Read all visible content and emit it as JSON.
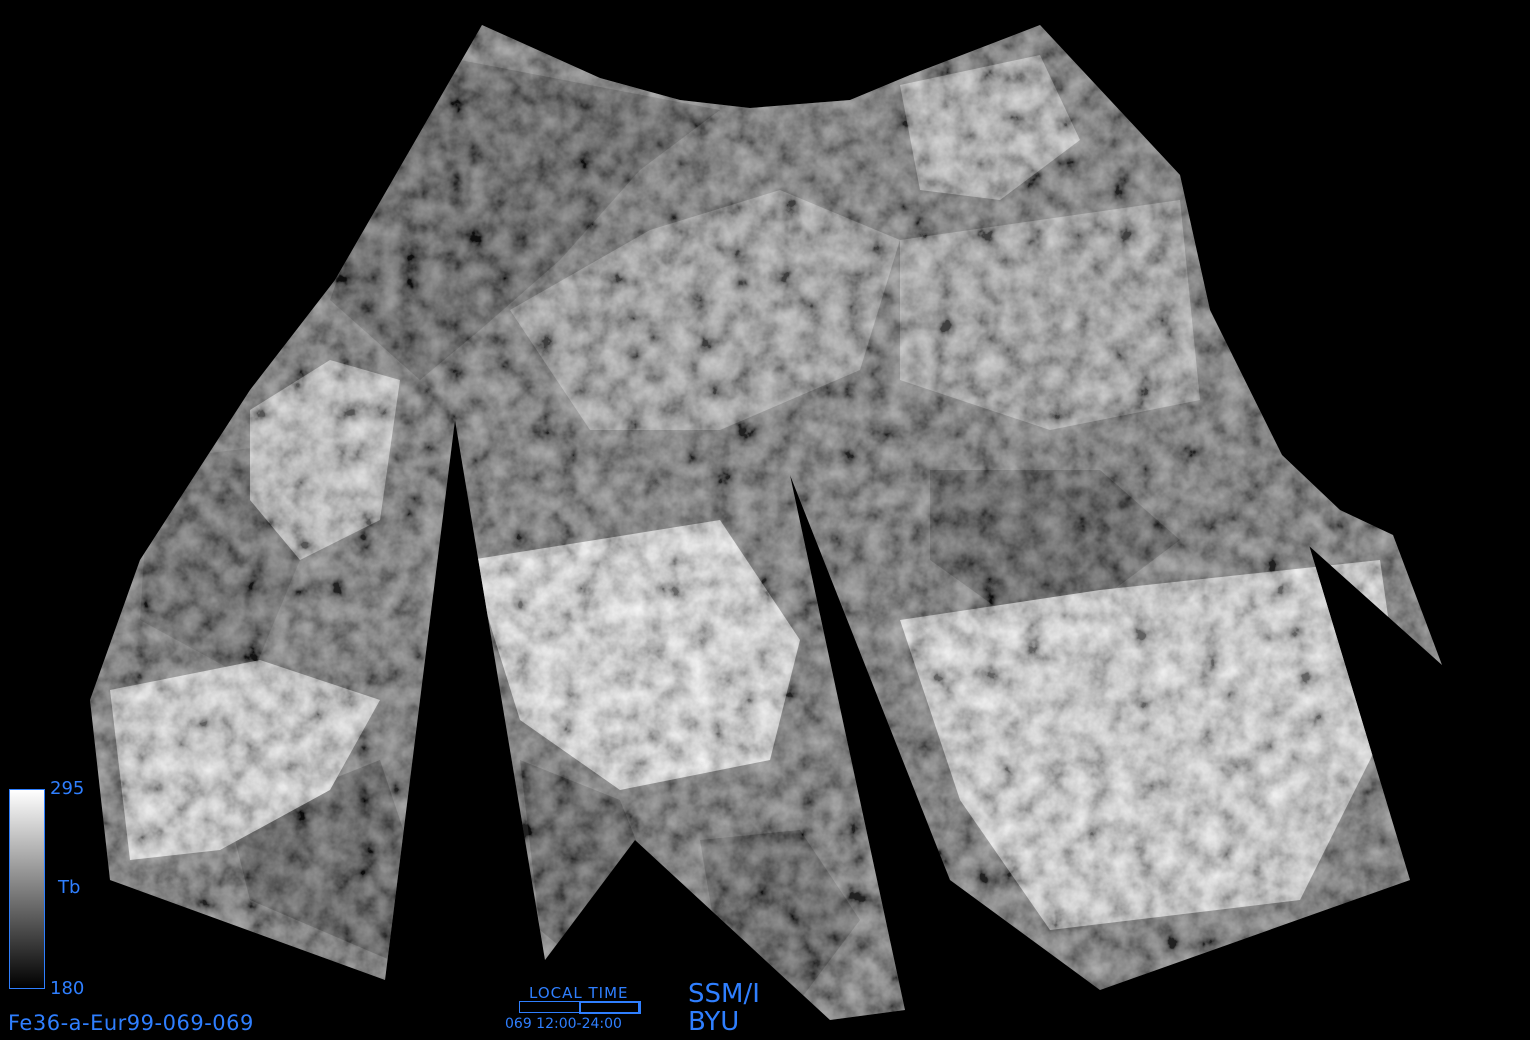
{
  "image": {
    "subject": "SSM/I brightness temperature mosaic over Europe and western Asia",
    "colors": {
      "background": "#000000",
      "annotation": "#2f7fff",
      "warm": "#ffffff",
      "cold": "#000000"
    }
  },
  "colorbar": {
    "max": "295",
    "min": "180",
    "label": "Tb"
  },
  "file_id": "Fe36-a-Eur99-069-069",
  "local_time": {
    "title": "LOCAL TIME",
    "range": "069 12:00-24:00"
  },
  "sensor": "SSM/I",
  "organization": "BYU"
}
